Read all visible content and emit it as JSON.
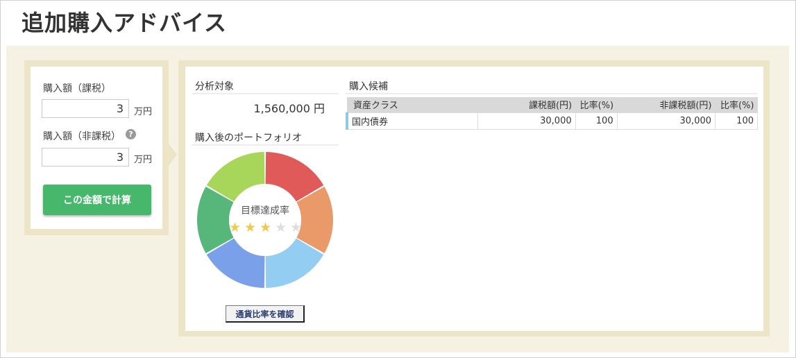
{
  "page": {
    "title": "追加購入アドバイス"
  },
  "input_panel": {
    "taxable_label": "購入額（課税）",
    "taxable_value": "3",
    "taxable_unit": "万円",
    "nontaxable_label": "購入額（非課税）",
    "nontaxable_value": "3",
    "nontaxable_unit": "万円",
    "help_icon": "?",
    "calculate_button": "この金額で計算"
  },
  "analysis": {
    "heading": "分析対象",
    "total": "1,560,000 円"
  },
  "portfolio": {
    "heading": "購入後のポートフォリオ",
    "goal_label": "目標達成率",
    "stars_filled": 3,
    "stars_total": 5,
    "star_on_color": "#f2c94c",
    "star_off_color": "#dedede",
    "currency_button": "通貨比率を確認",
    "segment_colors": [
      "#e05a5a",
      "#e99a68",
      "#93cdf2",
      "#7aa0ea",
      "#57b67a",
      "#a7d65a"
    ]
  },
  "candidates": {
    "heading": "購入候補",
    "columns": [
      "資産クラス",
      "課税額(円)",
      "比率(%)",
      "非課税額(円)",
      "比率(%)"
    ],
    "rows": [
      [
        "国内債券",
        "30,000",
        "100",
        "30,000",
        "100"
      ]
    ]
  }
}
